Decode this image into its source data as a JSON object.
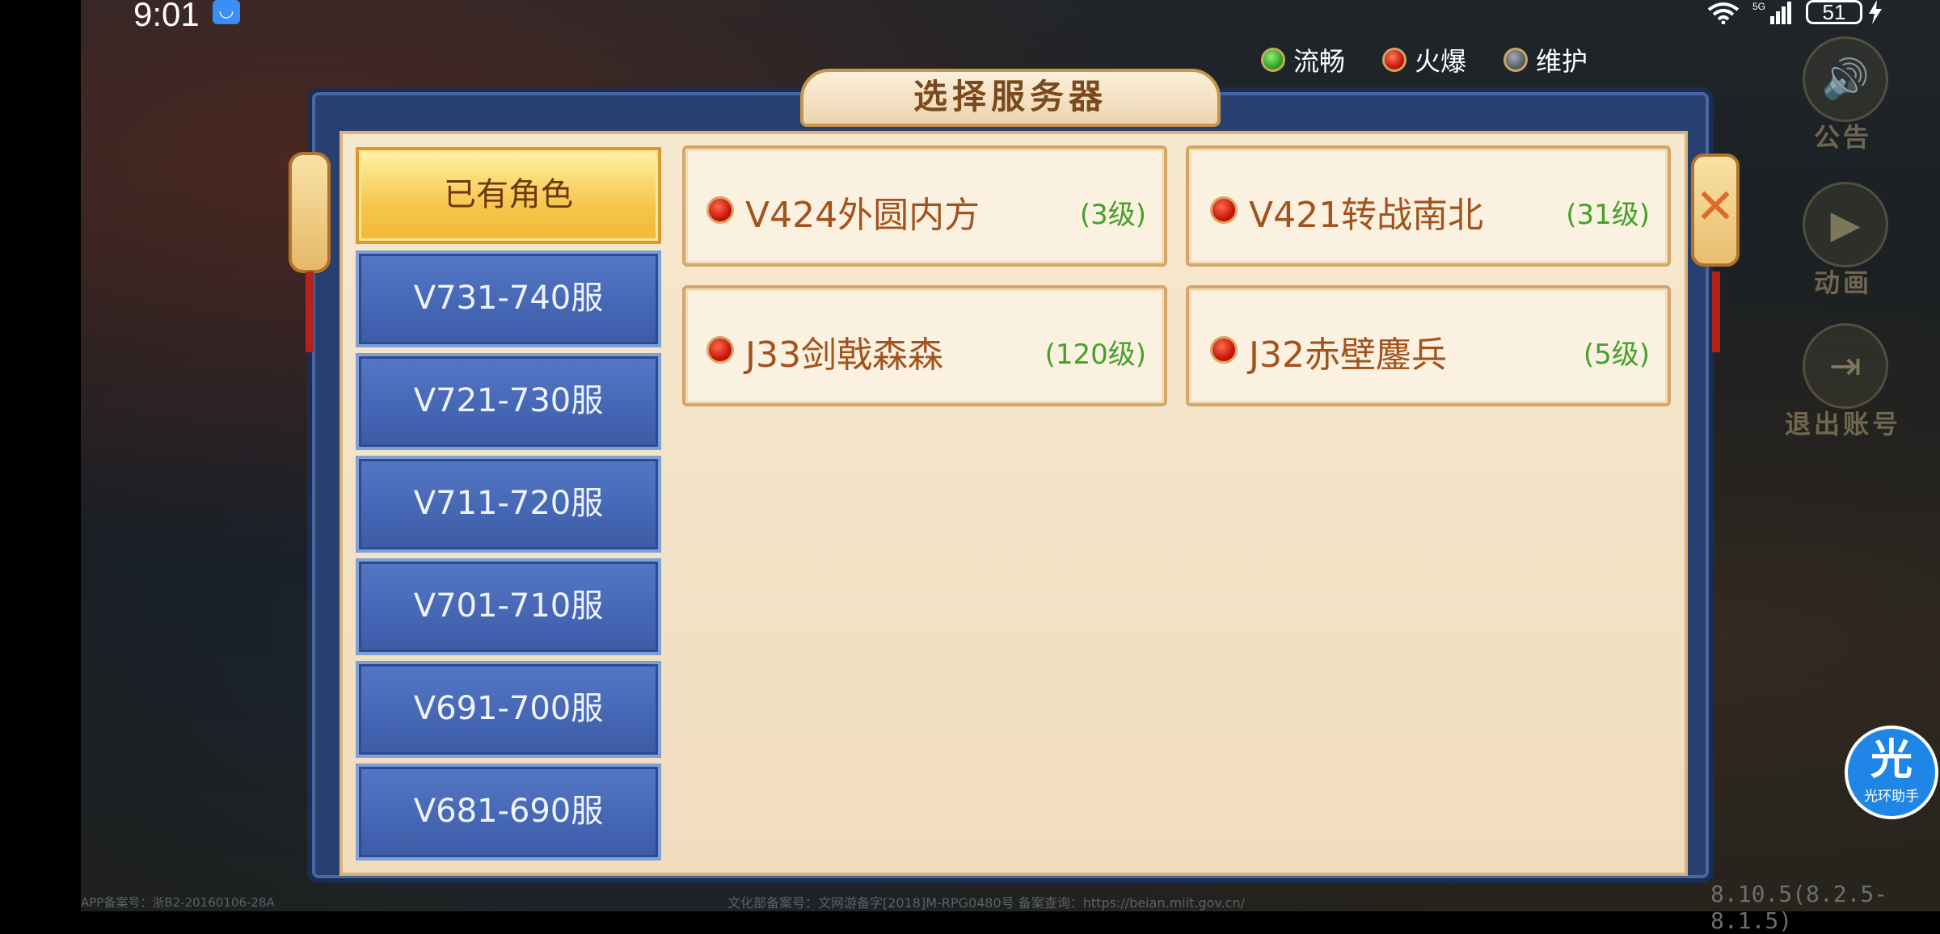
{
  "status_bar": {
    "time": "9:01",
    "signal_label": "5G",
    "battery": "51"
  },
  "legend": [
    {
      "label": "流畅",
      "color": "#3bb52b"
    },
    {
      "label": "火爆",
      "color": "#d6231b"
    },
    {
      "label": "维护",
      "color": "#6b6f7a"
    }
  ],
  "dialog": {
    "title": "选择服务器",
    "close_glyph": "✕"
  },
  "categories": [
    {
      "label": "已有角色",
      "selected": true
    },
    {
      "label": "V731-740服",
      "selected": false
    },
    {
      "label": "V721-730服",
      "selected": false
    },
    {
      "label": "V711-720服",
      "selected": false
    },
    {
      "label": "V701-710服",
      "selected": false
    },
    {
      "label": "V691-700服",
      "selected": false
    },
    {
      "label": "V681-690服",
      "selected": false
    }
  ],
  "servers": [
    {
      "name": "V424外圆内方",
      "level": "(3级)",
      "status": "火爆"
    },
    {
      "name": "V421转战南北",
      "level": "(31级)",
      "status": "火爆"
    },
    {
      "name": "J33剑戟森森",
      "level": "(120级)",
      "status": "火爆"
    },
    {
      "name": "J32赤壁鏖兵",
      "level": "(5级)",
      "status": "火爆"
    }
  ],
  "side_buttons": [
    {
      "label": "公告",
      "icon": "speaker-icon",
      "glyph": "🔊"
    },
    {
      "label": "动画",
      "icon": "play-icon",
      "glyph": "▶"
    },
    {
      "label": "退出账号",
      "icon": "logout-icon",
      "glyph": "⇥"
    }
  ],
  "helper": {
    "glyph": "光",
    "label": "光环助手"
  },
  "footer": {
    "left": "APP备案号：浙B2-20160106-28A",
    "center": "文化部备案号：文网游备字[2018]M-RPG0480号   备案查询：https://beian.miit.gov.cn/",
    "version": "8.10.5(8.2.5-8.1.5)"
  }
}
